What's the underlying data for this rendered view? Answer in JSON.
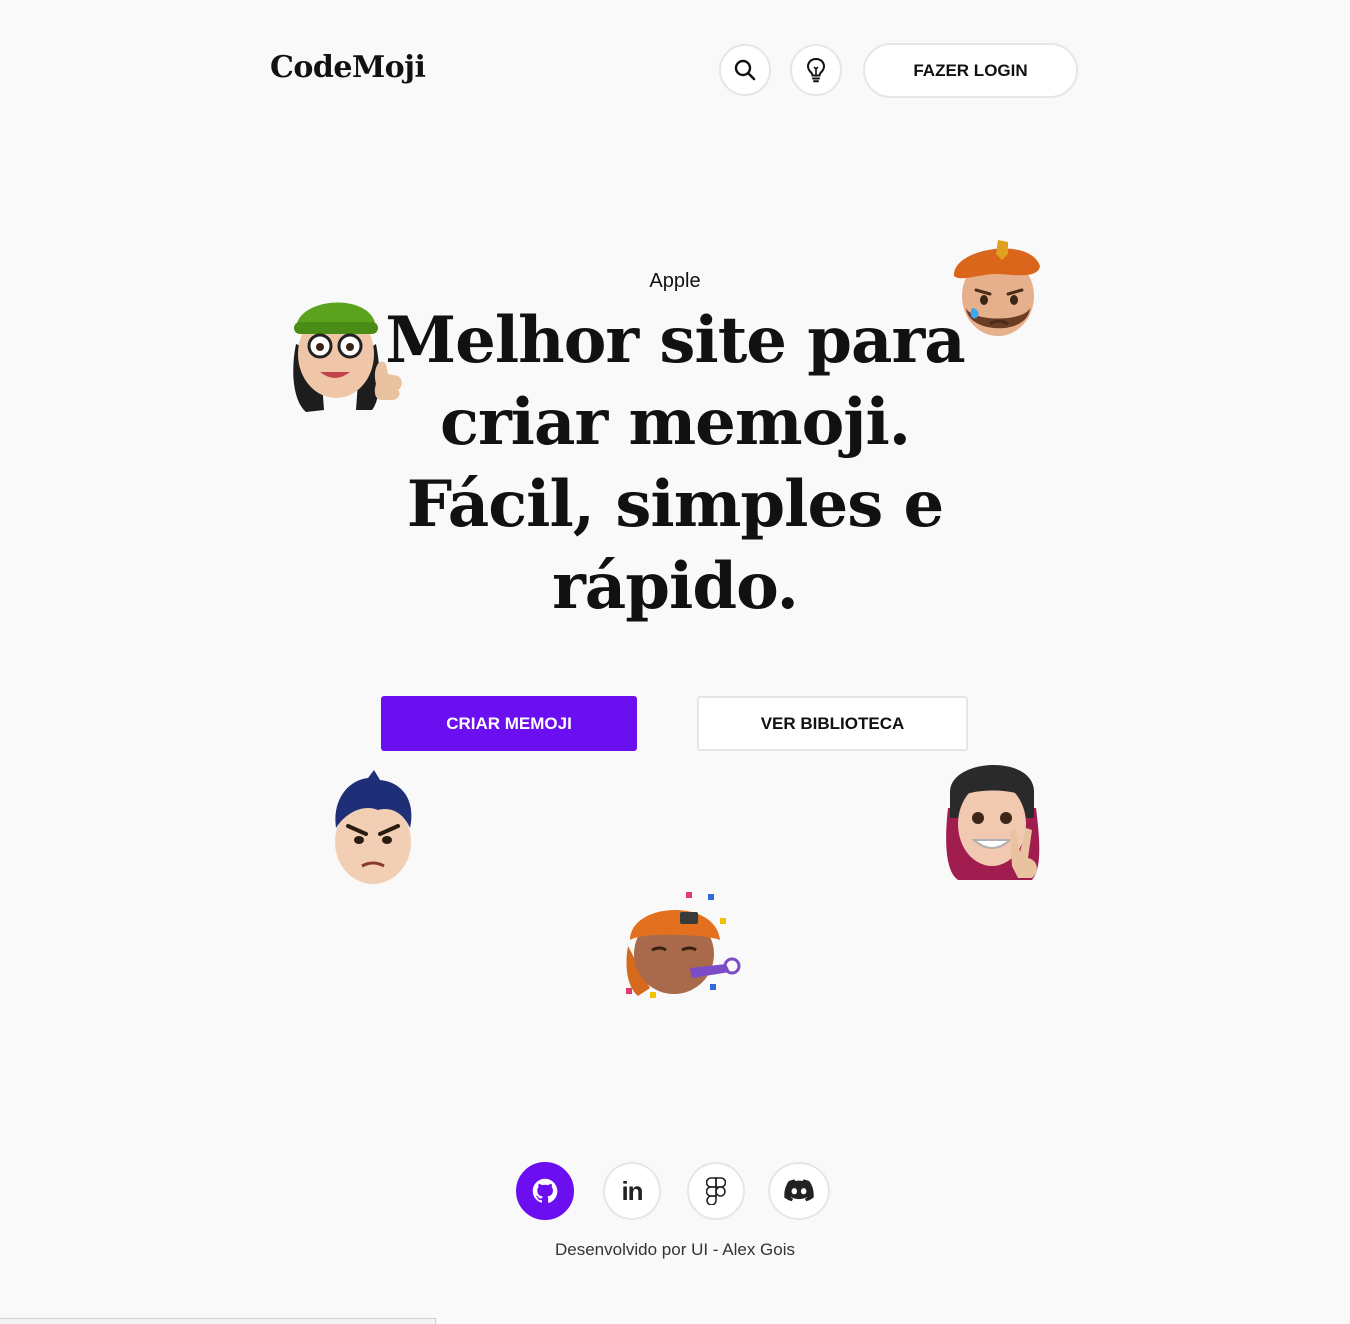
{
  "header": {
    "logo": "CodeMoji",
    "search_icon": "search-icon",
    "idea_icon": "lightbulb-icon",
    "login_label": "FAZER LOGIN"
  },
  "hero": {
    "eyebrow": "Apple",
    "headline_lines": [
      "Melhor site para",
      "criar memoji.",
      "Fácil, simples e",
      "rápido."
    ],
    "primary_cta": "CRIAR MEMOJI",
    "secondary_cta": "VER BIBLIOTECA"
  },
  "memojis": [
    {
      "name": "memoji-green-beanie-glasses-thumbs-up"
    },
    {
      "name": "memoji-crying-orange-beret"
    },
    {
      "name": "memoji-angry-blue-hair"
    },
    {
      "name": "memoji-peace-sign-braces"
    },
    {
      "name": "memoji-party-horn-orange-cap"
    }
  ],
  "footer": {
    "social": [
      {
        "name": "github-icon",
        "active": true
      },
      {
        "name": "linkedin-icon",
        "active": false,
        "text": "in"
      },
      {
        "name": "figma-icon",
        "active": false
      },
      {
        "name": "discord-icon",
        "active": false
      }
    ],
    "credit": "Desenvolvido por UI - Alex Gois"
  },
  "colors": {
    "accent": "#6b0ff0",
    "background": "#f9f9f9",
    "text": "#111111",
    "border": "#e6e6e6"
  }
}
